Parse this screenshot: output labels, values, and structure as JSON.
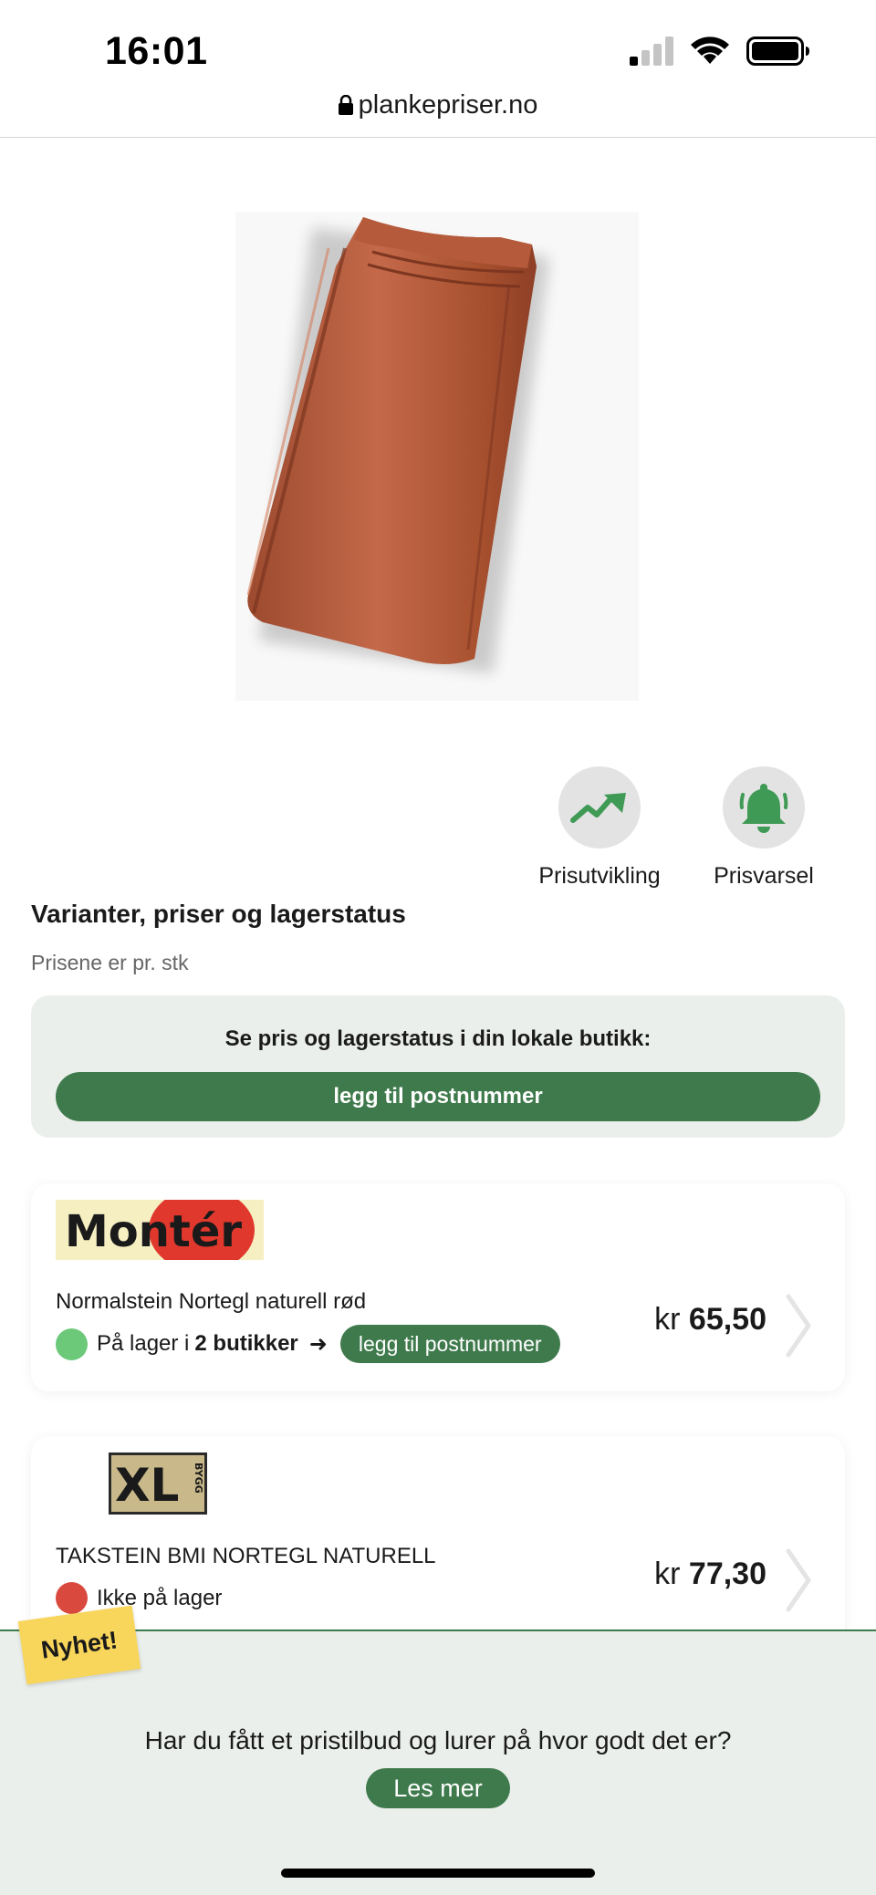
{
  "status_bar": {
    "time": "16:01"
  },
  "browser": {
    "url": "plankepriser.no"
  },
  "product": {
    "image_alt": "takstein"
  },
  "actions": [
    {
      "label": "Prisutvikling",
      "icon": "trend-up-icon"
    },
    {
      "label": "Prisvarsel",
      "icon": "bell-icon"
    }
  ],
  "section": {
    "title": "Varianter, priser og lagerstatus",
    "subtitle": "Prisene er pr. stk"
  },
  "local_store": {
    "prompt": "Se pris og lagerstatus i din lokale butikk:",
    "button": "legg til postnummer"
  },
  "stores": [
    {
      "logo_text": "Montér",
      "product_name": "Normalstein Nortegl naturell rød",
      "stock_prefix": "På lager i",
      "stock_count": "2 butikker",
      "stock_arrow": "➜",
      "stock_status": "in-stock",
      "pill": "legg til postnummer",
      "price_currency": "kr",
      "price_value": "65,50"
    },
    {
      "logo_text": "XL",
      "logo_subtext": "BYGG",
      "product_name": "TAKSTEIN BMI NORTEGL NATURELL",
      "stock_text": "Ikke på lager",
      "stock_status": "out-of-stock",
      "price_currency": "kr",
      "price_value": "77,30"
    }
  ],
  "banner": {
    "badge": "Nyhet!",
    "question": "Har du fått et pristilbud og lurer på hvor godt det er?",
    "button": "Les mer"
  },
  "colors": {
    "brand_green": "#3f7a4c",
    "panel_bg": "#ebefeb",
    "in_stock": "#6cc97a",
    "out_of_stock": "#d9493d",
    "badge_yellow": "#f8d55b",
    "tile_color": "#b65a3c"
  }
}
